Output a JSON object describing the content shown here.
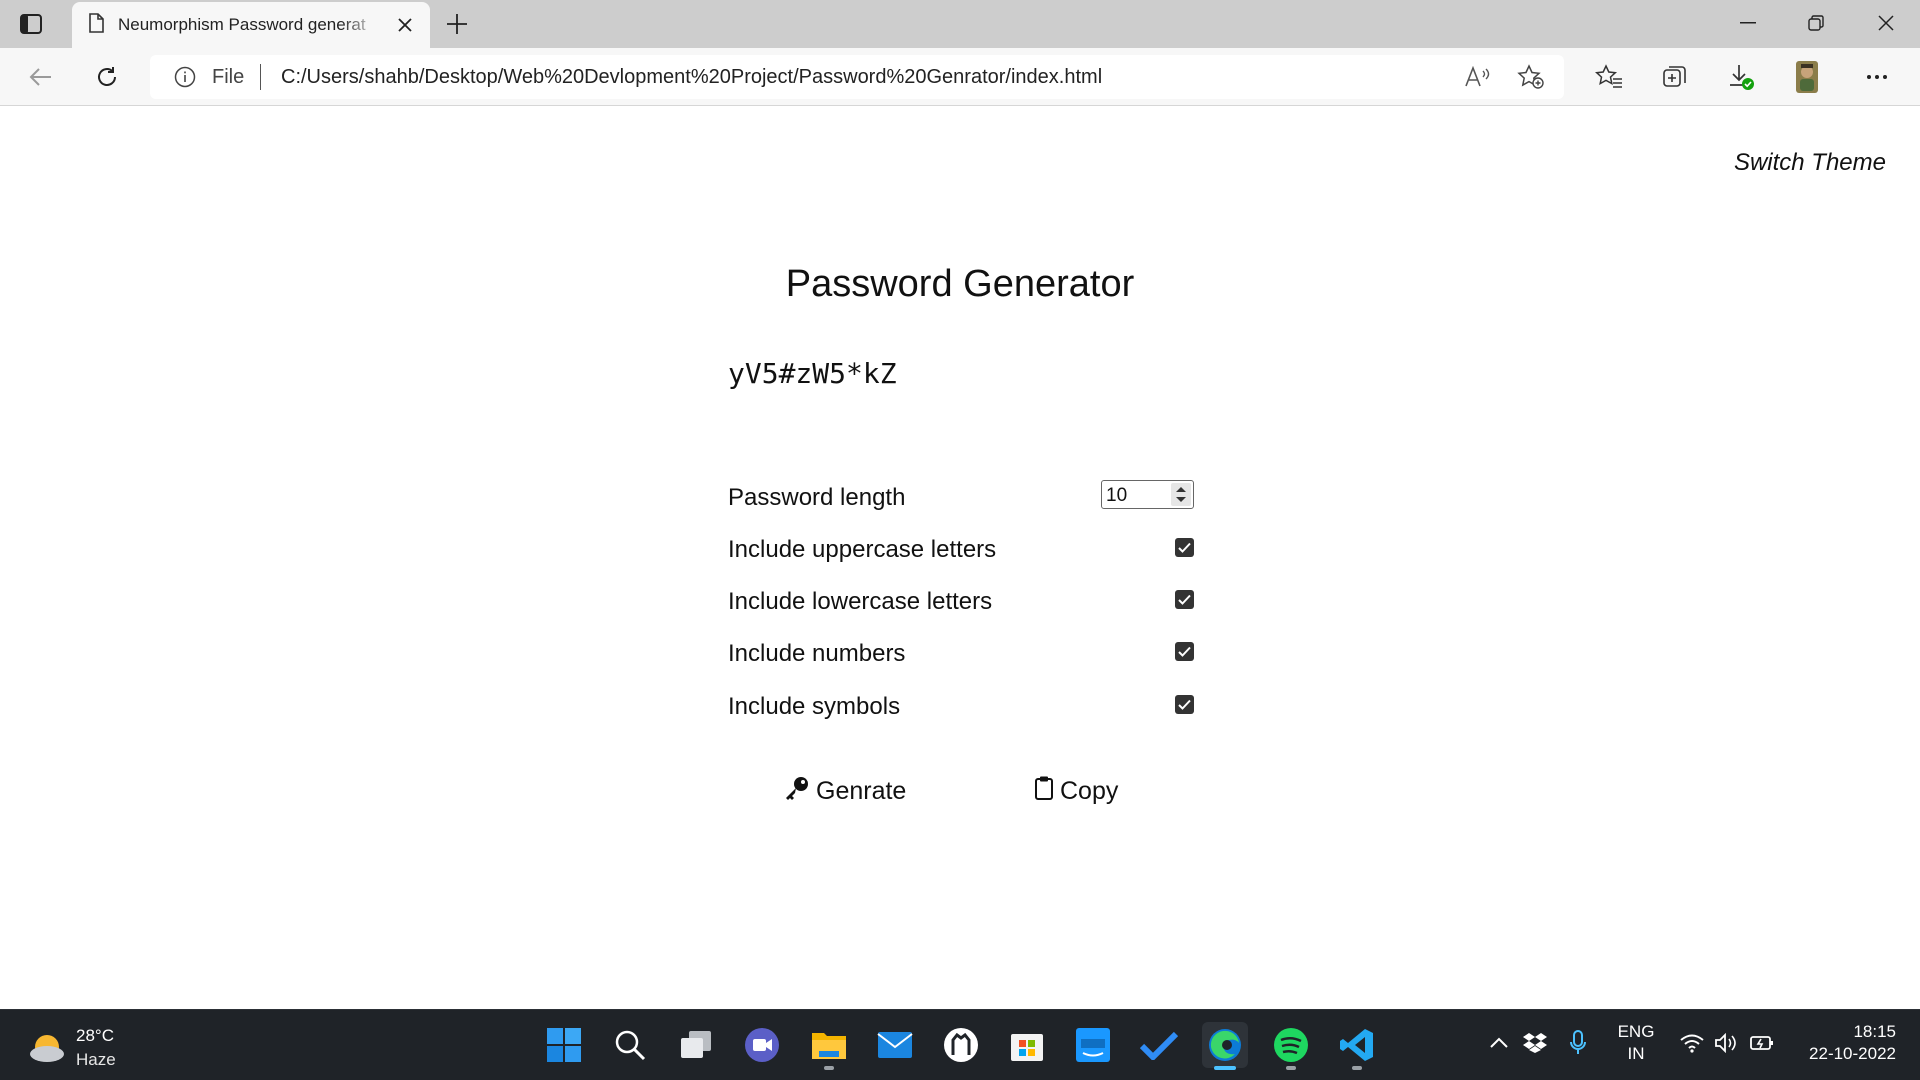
{
  "browser": {
    "tab_title": "Neumorphism Password generat",
    "address_scheme": "File",
    "address_url": "C:/Users/shahb/Desktop/Web%20Devlopment%20Project/Password%20Genrator/index.html"
  },
  "page": {
    "switch_theme": "Switch Theme",
    "title": "Password Generator",
    "password": "yV5#zW5*kZ",
    "options": [
      {
        "label": "Password length",
        "type": "number",
        "value": "10"
      },
      {
        "label": "Include uppercase letters",
        "type": "checkbox",
        "checked": true
      },
      {
        "label": "Include lowercase letters",
        "type": "checkbox",
        "checked": true
      },
      {
        "label": "Include numbers",
        "type": "checkbox",
        "checked": true
      },
      {
        "label": "Include symbols",
        "type": "checkbox",
        "checked": true
      }
    ],
    "generate_label": "Genrate",
    "copy_label": "Copy"
  },
  "taskbar": {
    "temperature": "28°C",
    "condition": "Haze",
    "apps": [
      "start-icon",
      "search-icon",
      "task-view-icon",
      "teams-icon",
      "file-explorer-icon",
      "mail-icon",
      "github-icon",
      "microsoft-store-icon",
      "prime-video-icon",
      "todo-icon",
      "edge-icon",
      "spotify-icon",
      "vscode-icon"
    ],
    "language_line1": "ENG",
    "language_line2": "IN",
    "time": "18:15",
    "date": "22-10-2022"
  },
  "colors": {
    "accent": "#4cc2ff",
    "taskbar_bg": "#1f2328",
    "tab_bar_bg": "#cdcdcd",
    "checkbox_fill": "#333333"
  }
}
